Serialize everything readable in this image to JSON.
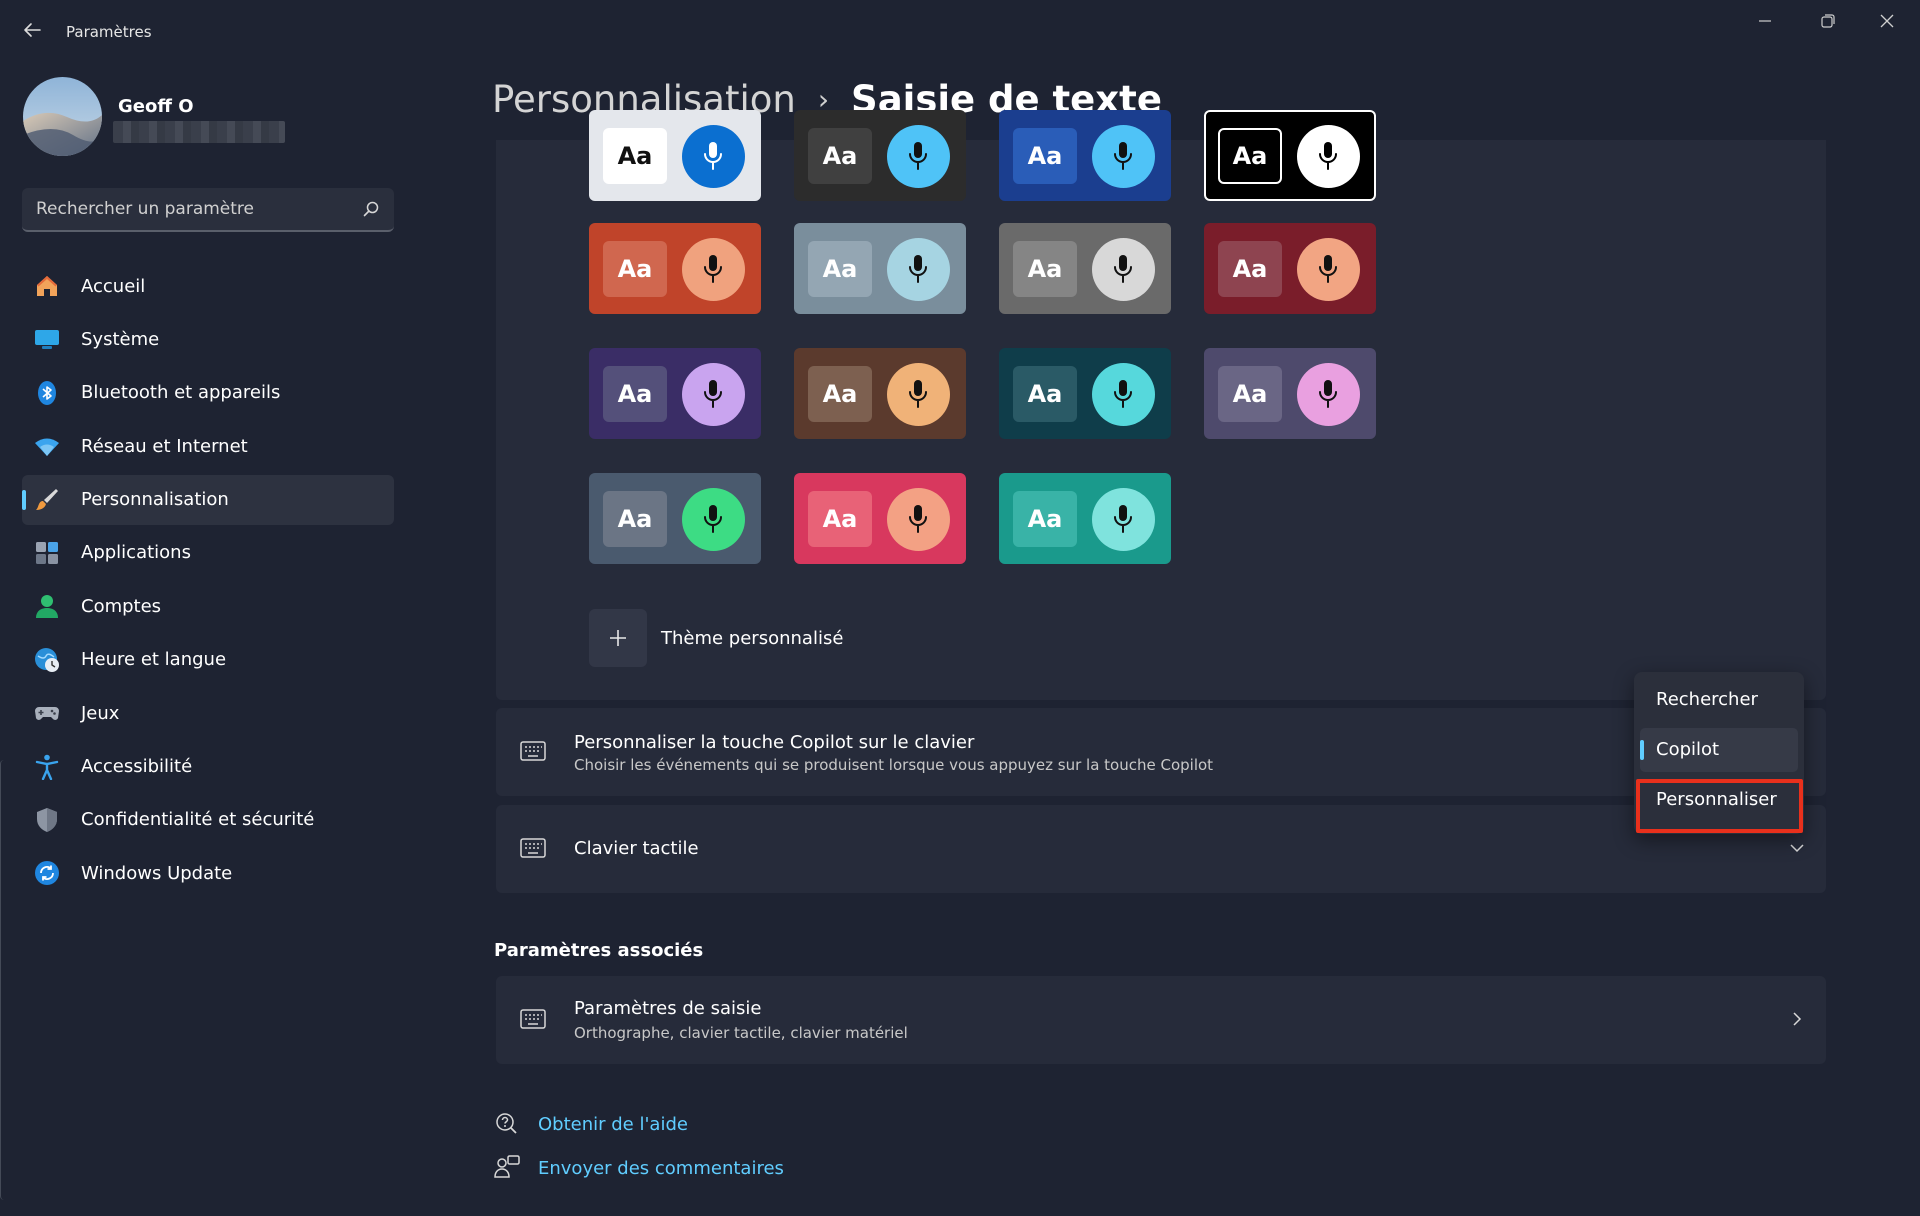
{
  "window": {
    "title": "Paramètres"
  },
  "user": {
    "name": "Geoff O"
  },
  "search": {
    "placeholder": "Rechercher un paramètre"
  },
  "sidebar": {
    "items": [
      {
        "label": "Accueil",
        "icon": "home-icon"
      },
      {
        "label": "Système",
        "icon": "display-icon"
      },
      {
        "label": "Bluetooth et appareils",
        "icon": "bluetooth-icon"
      },
      {
        "label": "Réseau et Internet",
        "icon": "wifi-icon"
      },
      {
        "label": "Personnalisation",
        "icon": "brush-icon",
        "active": true
      },
      {
        "label": "Applications",
        "icon": "apps-icon"
      },
      {
        "label": "Comptes",
        "icon": "account-icon"
      },
      {
        "label": "Heure et langue",
        "icon": "globe-clock-icon"
      },
      {
        "label": "Jeux",
        "icon": "gamepad-icon"
      },
      {
        "label": "Accessibilité",
        "icon": "accessibility-icon"
      },
      {
        "label": "Confidentialité et sécurité",
        "icon": "shield-icon"
      },
      {
        "label": "Windows Update",
        "icon": "update-icon"
      }
    ]
  },
  "breadcrumb": {
    "parent": "Personnalisation",
    "separator": "›",
    "current": "Saisie de texte"
  },
  "themes": {
    "aa_label": "Aa",
    "cards": [
      {
        "bg": "#e4e7ec",
        "aa_bg": "#ffffff",
        "aa_fg": "#111111",
        "mic_bg": "#0b6fd0",
        "mic_fg": "#ffffff"
      },
      {
        "bg": "#2c2c2c",
        "aa_bg": "#404040",
        "aa_fg": "#ffffff",
        "mic_bg": "#4fc3f7",
        "mic_fg": "#111111"
      },
      {
        "bg": "#1b3e8f",
        "aa_bg": "#2a5db8",
        "aa_fg": "#ffffff",
        "mic_bg": "#4fc3f7",
        "mic_fg": "#111111"
      },
      {
        "bg": "#000000",
        "aa_bg": "#000000",
        "aa_fg": "#ffffff",
        "mic_bg": "#ffffff",
        "mic_fg": "#000000",
        "selected": true
      },
      {
        "bg": "#c0442a",
        "aa_bg": "#d0674f",
        "aa_fg": "#ffffff",
        "mic_bg": "#f0a27e",
        "mic_fg": "#111111"
      },
      {
        "bg": "#7a8e9c",
        "aa_bg": "#94a6b3",
        "aa_fg": "#ffffff",
        "mic_bg": "#a6d4e2",
        "mic_fg": "#111111"
      },
      {
        "bg": "#6a6a6a",
        "aa_bg": "#858585",
        "aa_fg": "#ffffff",
        "mic_bg": "#d8d8d8",
        "mic_fg": "#111111"
      },
      {
        "bg": "#7a1d2a",
        "aa_bg": "#8e4450",
        "aa_fg": "#ffffff",
        "mic_bg": "#f2a583",
        "mic_fg": "#111111"
      },
      {
        "bg": "#3a2d66",
        "aa_bg": "#54507a",
        "aa_fg": "#ffffff",
        "mic_bg": "#c9a4ef",
        "mic_fg": "#111111"
      },
      {
        "bg": "#5b3a2d",
        "aa_bg": "#7d6050",
        "aa_fg": "#ffffff",
        "mic_bg": "#f0b278",
        "mic_fg": "#111111"
      },
      {
        "bg": "#0f3d4a",
        "aa_bg": "#2a5a66",
        "aa_fg": "#ffffff",
        "mic_bg": "#56d8dc",
        "mic_fg": "#111111"
      },
      {
        "bg": "#4e4a6c",
        "aa_bg": "#6a6685",
        "aa_fg": "#ffffff",
        "mic_bg": "#e9a0e0",
        "mic_fg": "#111111"
      },
      {
        "bg": "#4a5a6e",
        "aa_bg": "#6b7585",
        "aa_fg": "#ffffff",
        "mic_bg": "#3ddc84",
        "mic_fg": "#111111"
      },
      {
        "bg": "#d8385e",
        "aa_bg": "#e86277",
        "aa_fg": "#ffffff",
        "mic_bg": "#f3a184",
        "mic_fg": "#111111"
      },
      {
        "bg": "#1a9a8c",
        "aa_bg": "#39b3a7",
        "aa_fg": "#ffffff",
        "mic_bg": "#7fe3dd",
        "mic_fg": "#111111"
      }
    ],
    "custom_label": "Thème personnalisé"
  },
  "copilot_row": {
    "title": "Personnaliser la touche Copilot sur le clavier",
    "subtitle": "Choisir les événements qui se produisent lorsque vous appuyez sur la touche Copilot"
  },
  "dropdown": {
    "items": [
      {
        "label": "Rechercher"
      },
      {
        "label": "Copilot",
        "selected": true
      },
      {
        "label": "Personnaliser",
        "highlighted": true
      }
    ]
  },
  "touch_keyboard_row": {
    "title": "Clavier tactile"
  },
  "related": {
    "title": "Paramètres associés",
    "typing_row": {
      "title": "Paramètres de saisie",
      "subtitle": "Orthographe, clavier tactile, clavier matériel"
    }
  },
  "links": {
    "help": "Obtenir de l'aide",
    "feedback": "Envoyer des commentaires"
  },
  "colors": {
    "accent": "#60cdff",
    "highlight_box": "#e8301c",
    "background": "#1e2332",
    "card": "#262b3a"
  }
}
